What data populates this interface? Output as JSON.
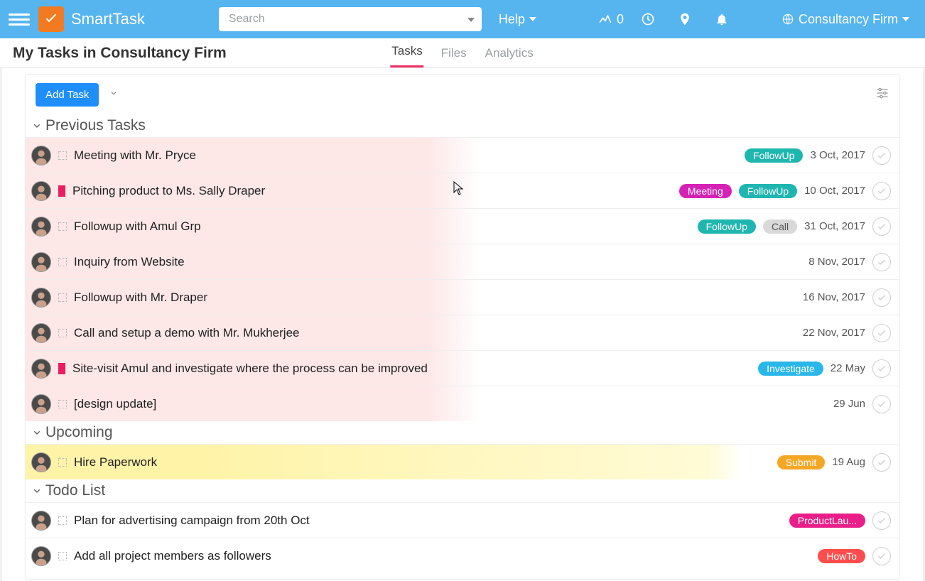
{
  "header": {
    "brand": "SmartTask",
    "search_placeholder": "Search",
    "help_label": "Help",
    "stats_count": "0",
    "org_label": "Consultancy Firm"
  },
  "page": {
    "title": "My Tasks in Consultancy Firm",
    "tabs": [
      {
        "label": "Tasks",
        "active": true
      },
      {
        "label": "Files",
        "active": false
      },
      {
        "label": "Analytics",
        "active": false
      }
    ],
    "add_button": "Add Task"
  },
  "sections": [
    {
      "name": "Previous Tasks",
      "style": "pink",
      "rows": [
        {
          "title": "Meeting with Mr. Pryce",
          "priority": false,
          "tags": [
            {
              "label": "FollowUp",
              "color": "p-teal"
            }
          ],
          "date": "3 Oct, 2017"
        },
        {
          "title": "Pitching product to Ms. Sally Draper",
          "priority": true,
          "tags": [
            {
              "label": "Meeting",
              "color": "p-magenta"
            },
            {
              "label": "FollowUp",
              "color": "p-teal"
            }
          ],
          "date": "10 Oct, 2017"
        },
        {
          "title": "Followup with Amul Grp",
          "priority": false,
          "tags": [
            {
              "label": "FollowUp",
              "color": "p-teal"
            },
            {
              "label": "Call",
              "color": "p-gray"
            }
          ],
          "date": "31 Oct, 2017"
        },
        {
          "title": "Inquiry from Website",
          "priority": false,
          "tags": [],
          "date": "8 Nov, 2017"
        },
        {
          "title": "Followup with Mr. Draper",
          "priority": false,
          "tags": [],
          "date": "16 Nov, 2017"
        },
        {
          "title": "Call and setup a demo with Mr. Mukherjee",
          "priority": false,
          "tags": [],
          "date": "22 Nov, 2017"
        },
        {
          "title": "Site-visit Amul and investigate where the process can be improved",
          "priority": true,
          "tags": [
            {
              "label": "Investigate",
              "color": "p-cyan"
            }
          ],
          "date": "22 May"
        },
        {
          "title": "[design update]",
          "priority": false,
          "tags": [],
          "date": "29 Jun"
        }
      ]
    },
    {
      "name": "Upcoming",
      "style": "yellow",
      "rows": [
        {
          "title": "Hire Paperwork",
          "priority": false,
          "tags": [
            {
              "label": "Submit",
              "color": "p-orange"
            }
          ],
          "date": "19 Aug"
        }
      ]
    },
    {
      "name": "Todo List",
      "style": "plain",
      "rows": [
        {
          "title": "Plan for advertising campaign from 20th Oct",
          "priority": false,
          "tags": [
            {
              "label": "ProductLau...",
              "color": "p-pink"
            }
          ],
          "date": ""
        },
        {
          "title": "Add all project members as followers",
          "priority": false,
          "tags": [
            {
              "label": "HowTo",
              "color": "p-red"
            }
          ],
          "date": ""
        }
      ]
    }
  ]
}
